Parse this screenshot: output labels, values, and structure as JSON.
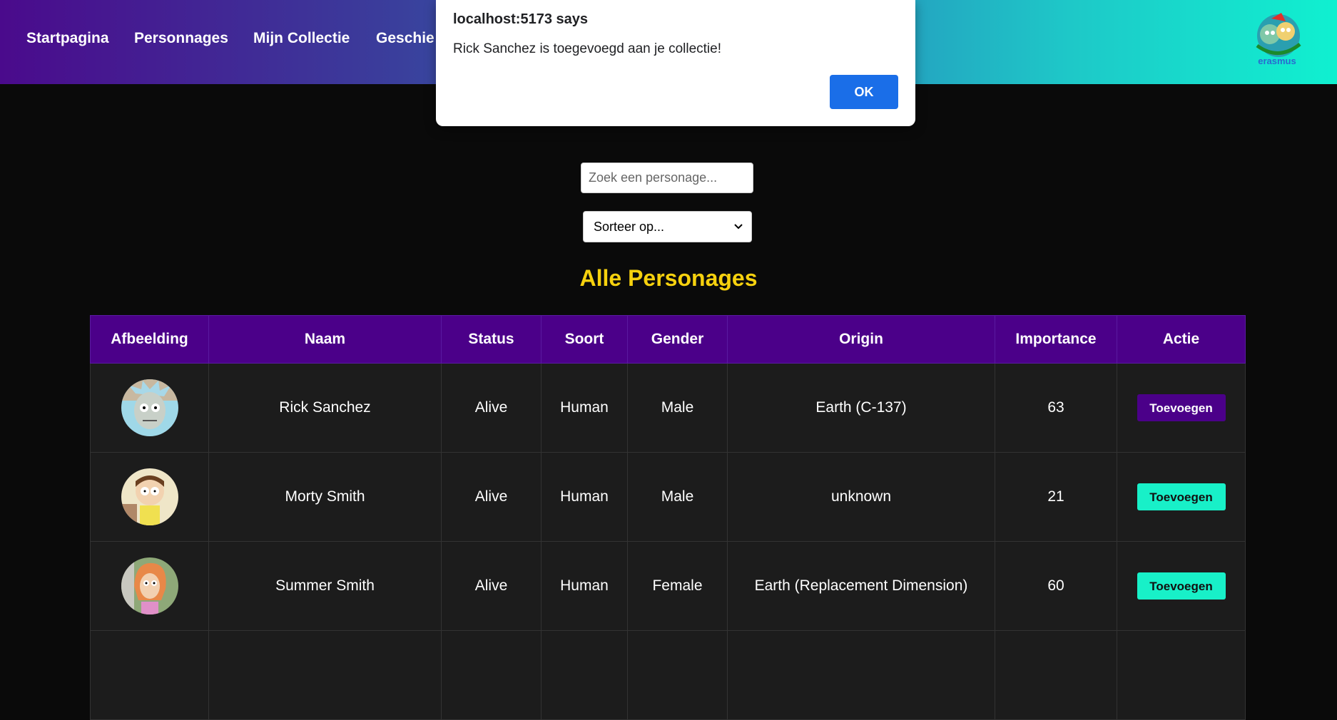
{
  "nav": {
    "links": [
      "Startpagina",
      "Personnages",
      "Mijn Collectie",
      "Geschie"
    ],
    "logo_text": "erasmus"
  },
  "dialog": {
    "title": "localhost:5173 says",
    "message": "Rick Sanchez is toegevoegd aan je collectie!",
    "ok_label": "OK"
  },
  "search": {
    "placeholder": "Zoek een personage..."
  },
  "sort": {
    "selected": "Sorteer op..."
  },
  "section_title": "Alle Personages",
  "table": {
    "headers": [
      "Afbeelding",
      "Naam",
      "Status",
      "Soort",
      "Gender",
      "Origin",
      "Importance",
      "Actie"
    ],
    "rows": [
      {
        "name": "Rick Sanchez",
        "status": "Alive",
        "species": "Human",
        "gender": "Male",
        "origin": "Earth (C-137)",
        "importance": "63",
        "action": "Toevoegen",
        "action_color": "#4b0089"
      },
      {
        "name": "Morty Smith",
        "status": "Alive",
        "species": "Human",
        "gender": "Male",
        "origin": "unknown",
        "importance": "21",
        "action": "Toevoegen",
        "action_color": "#18f0c8"
      },
      {
        "name": "Summer Smith",
        "status": "Alive",
        "species": "Human",
        "gender": "Female",
        "origin": "Earth (Replacement Dimension)",
        "importance": "60",
        "action": "Toevoegen",
        "action_color": "#18f0c8"
      }
    ]
  },
  "colors": {
    "nav_start": "#4a0a8c",
    "nav_end": "#10f0d0",
    "header_bg": "#4b0089",
    "title_yellow": "#f6d10e",
    "dialog_button": "#1a6ee8"
  }
}
